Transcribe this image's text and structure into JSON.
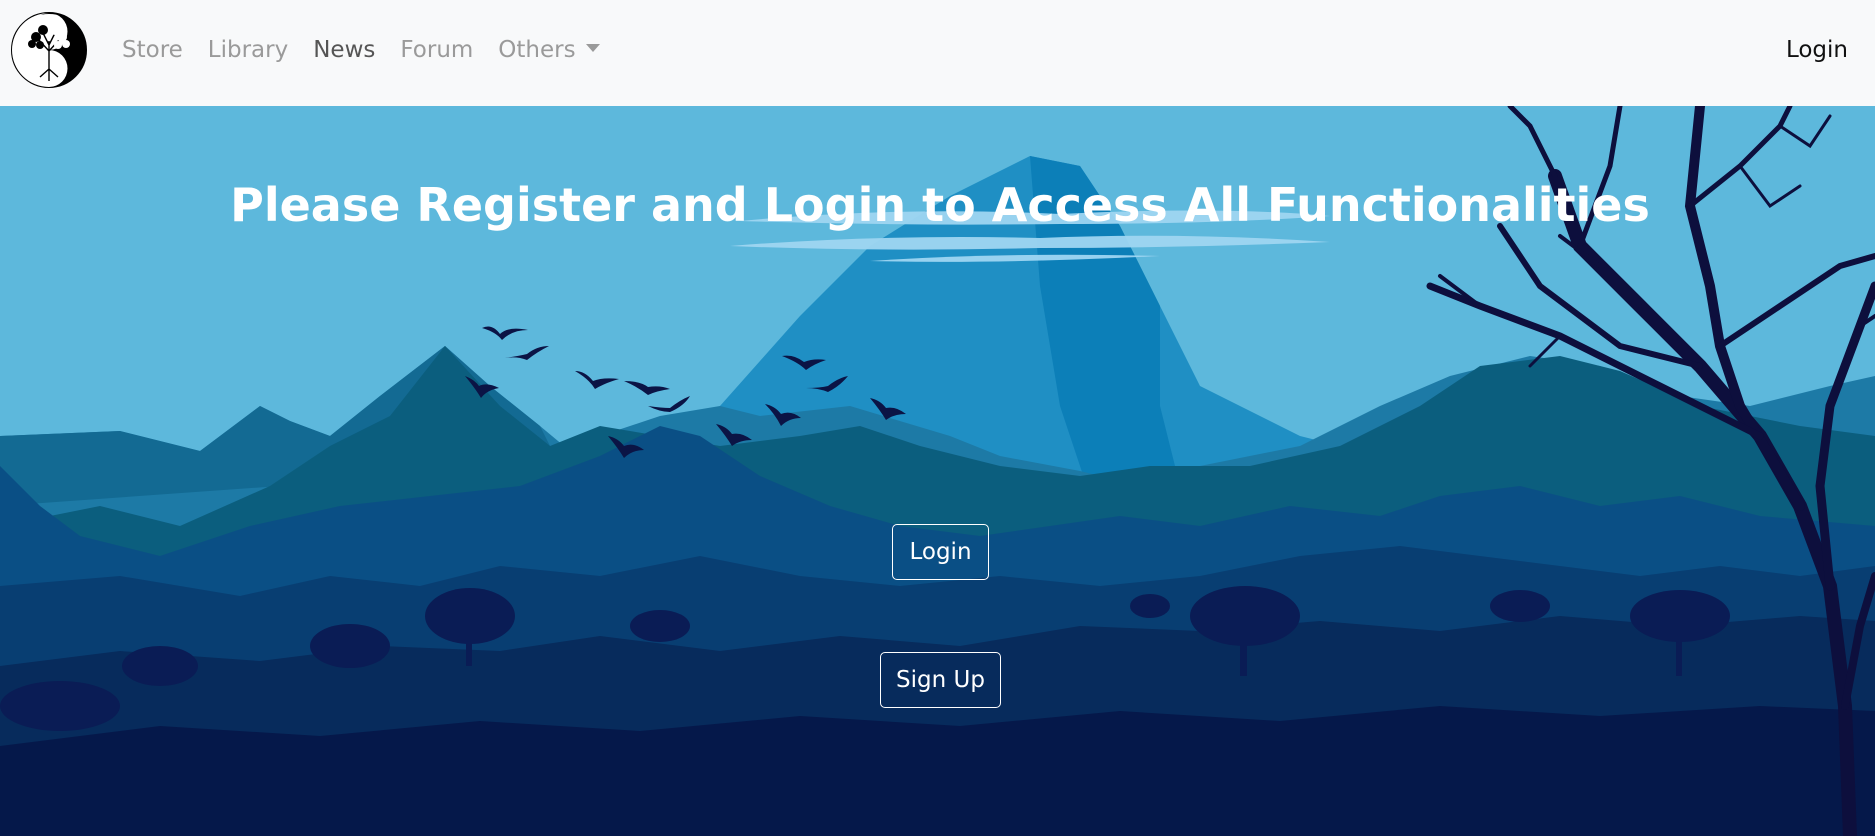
{
  "navbar": {
    "logo_icon": "yin-yang-tree-icon",
    "links": [
      {
        "label": "Store",
        "active": false
      },
      {
        "label": "Library",
        "active": false
      },
      {
        "label": "News",
        "active": true
      },
      {
        "label": "Forum",
        "active": false
      }
    ],
    "dropdown": {
      "label": "Others",
      "icon": "caret-down-icon"
    },
    "login_label": "Login"
  },
  "hero": {
    "headline": "Please Register and Login to Access All Functionalities",
    "login_button": "Login",
    "signup_button": "Sign Up"
  },
  "colors": {
    "navbar_bg": "#f8f9fa",
    "sky": "#5db8dc",
    "text_on_hero": "#ffffff"
  }
}
